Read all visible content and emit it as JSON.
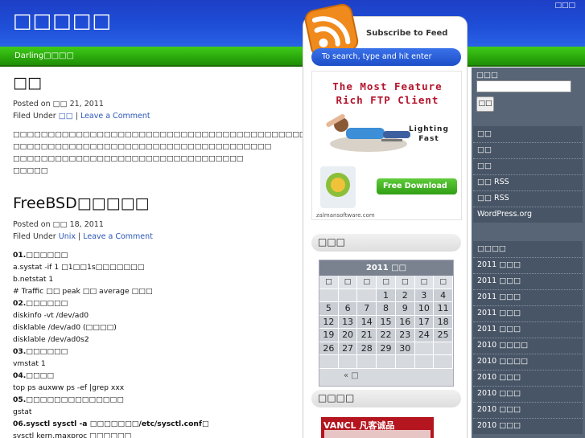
{
  "header": {
    "site_title": "□□□□□",
    "top_link": "□□□"
  },
  "nav": {
    "items": [
      "Darling□□",
      "□□"
    ]
  },
  "posts": [
    {
      "title": "□□",
      "posted": "Posted on □□ 21, 2011",
      "filed_label": "Filed Under",
      "category": "□□",
      "comment": "Leave a Comment",
      "lines": [
        "□□□□□□□□□□□□□□□□□□□□□□□□□□□□□□□□□□□□□□□□□□□□□□□□□",
        "□□□□□□□□□□□□□□□□□□□□□□□□□□□□□□□□□□□□□",
        "□□□□□□□□□□□□□□□□□□□□□□□□□□□□□□□□□",
        "□□□□□"
      ]
    },
    {
      "title": "FreeBSD□□□□□",
      "posted": "Posted on □□ 18, 2011",
      "filed_label": "Filed Under",
      "category": "Unix",
      "comment": "Leave a Comment",
      "lines": [
        "01.□□□□□□",
        "a.systat -if 1 □1□□1s□□□□□□□",
        "b.netstat 1",
        "# Traffic □□ peak □□ average □□□",
        "02.□□□□□□",
        "diskinfo -vt /dev/ad0",
        "disklable /dev/ad0 (□□□□)",
        "disklable /dev/ad0s2",
        "03.□□□□□□",
        "vmstat 1",
        "04.□□□□",
        "top ps auxww ps -ef |grep xxx",
        "05.□□□□□□□□□□□□□□",
        "gstat",
        "06.sysctl sysctl -a □□□□□□□/etc/sysctl.conf□",
        "sysctl kern.maxproc □□□□□□"
      ],
      "bold_lines": [
        0,
        4,
        8,
        10,
        12,
        14
      ]
    }
  ],
  "middle": {
    "subscribe": "Subscribe to Feed",
    "search_placeholder": "To search, type and hit enter",
    "ad_ftp": {
      "headline1": "The Most Feature",
      "headline2": "Rich FTP Client",
      "tag1": "Lighting",
      "tag2": "Fast",
      "button": "Free Download",
      "url": "zalmansoftware.com"
    },
    "archive_heading": "□□□",
    "calendar": {
      "caption": "2011 □□",
      "weekdays": [
        "□",
        "□",
        "□",
        "□",
        "□",
        "□",
        "□"
      ],
      "days": [
        "",
        "",
        "",
        "1",
        "2",
        "3",
        "4",
        "5",
        "6",
        "7",
        "8",
        "9",
        "10",
        "11",
        "12",
        "13",
        "14",
        "15",
        "16",
        "17",
        "18",
        "19",
        "20",
        "21",
        "22",
        "23",
        "24",
        "25",
        "26",
        "27",
        "28",
        "29",
        "30",
        "",
        "",
        "",
        "",
        "",
        "",
        "",
        "",
        ""
      ],
      "prev": "« □"
    },
    "links_heading": "□□□□",
    "ad_vancl": "VANCL 凡客诚品"
  },
  "right": {
    "search_label": "□□□",
    "search_button": "□□",
    "meta_title": "□□",
    "meta_items": [
      "□□",
      "□□",
      "□□ RSS",
      "□□ RSS",
      "WordPress.org"
    ],
    "archives_title": "□□□□",
    "archives": [
      "2011 □□□",
      "2011 □□□",
      "2011 □□□",
      "2011 □□□",
      "2011 □□□",
      "2010 □□□□",
      "2010 □□□□",
      "2010 □□□",
      "2010 □□□",
      "2010 □□□",
      "2010 □□□"
    ]
  },
  "colors": {
    "header_blue": "#1f4fd8",
    "nav_green": "#2aa70b",
    "sidebar": "#576577",
    "link": "#2b56b8"
  }
}
